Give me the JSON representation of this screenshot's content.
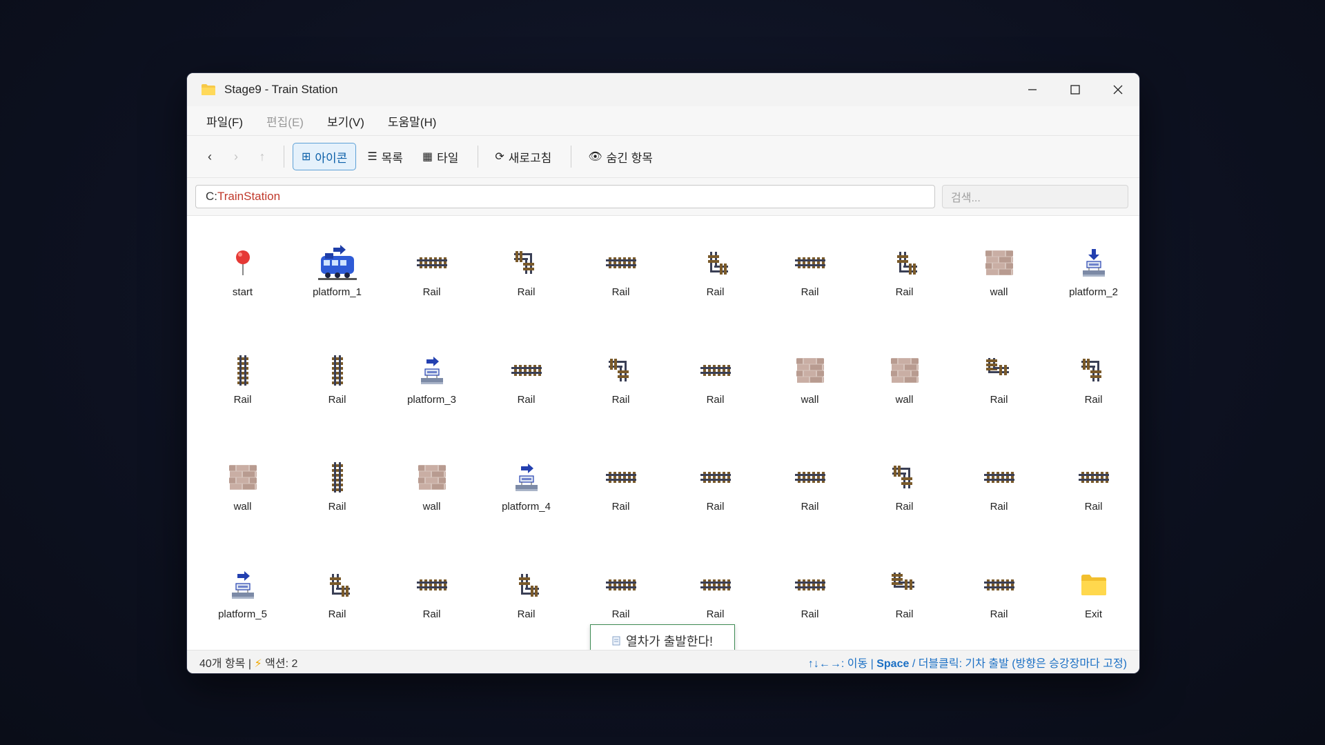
{
  "window": {
    "title": "Stage9 - Train Station",
    "controls": {
      "minimize": "—",
      "maximize": "☐",
      "close": "✕"
    }
  },
  "menu": [
    {
      "label": "파일(F)",
      "disabled": false
    },
    {
      "label": "편집(E)",
      "disabled": true
    },
    {
      "label": "보기(V)",
      "disabled": false
    },
    {
      "label": "도움말(H)",
      "disabled": false
    }
  ],
  "toolbar": {
    "back": "‹",
    "forward": "›",
    "up": "↑",
    "view_icon": "아이콘",
    "view_list": "목록",
    "view_tile": "타일",
    "refresh": "새로고침",
    "hidden_items": "숨긴 항목"
  },
  "address": {
    "drive": "C:",
    "path": "TrainStation"
  },
  "search": {
    "placeholder": "검색..."
  },
  "items": [
    {
      "label": "start",
      "icon": "pin-icon"
    },
    {
      "label": "platform_1",
      "icon": "train-icon"
    },
    {
      "label": "Rail",
      "icon": "rail-horizontal-icon"
    },
    {
      "label": "Rail",
      "icon": "rail-corner-down-icon"
    },
    {
      "label": "Rail",
      "icon": "rail-horizontal-icon"
    },
    {
      "label": "Rail",
      "icon": "rail-corner-up-icon"
    },
    {
      "label": "Rail",
      "icon": "rail-horizontal-icon"
    },
    {
      "label": "Rail",
      "icon": "rail-corner-up-icon"
    },
    {
      "label": "wall",
      "icon": "brick-wall-icon"
    },
    {
      "label": "platform_2",
      "icon": "platform-down-icon"
    },
    {
      "label": "Rail",
      "icon": "rail-vertical-icon"
    },
    {
      "label": "Rail",
      "icon": "rail-vertical-icon"
    },
    {
      "label": "platform_3",
      "icon": "platform-right-icon"
    },
    {
      "label": "Rail",
      "icon": "rail-horizontal-icon"
    },
    {
      "label": "Rail",
      "icon": "rail-corner-down-icon"
    },
    {
      "label": "Rail",
      "icon": "rail-horizontal-icon"
    },
    {
      "label": "wall",
      "icon": "brick-wall-icon"
    },
    {
      "label": "wall",
      "icon": "brick-wall-icon"
    },
    {
      "label": "Rail",
      "icon": "rail-corner-right-icon"
    },
    {
      "label": "Rail",
      "icon": "rail-corner-down-icon"
    },
    {
      "label": "wall",
      "icon": "brick-wall-icon"
    },
    {
      "label": "Rail",
      "icon": "rail-vertical-icon"
    },
    {
      "label": "wall",
      "icon": "brick-wall-icon"
    },
    {
      "label": "platform_4",
      "icon": "platform-right-icon"
    },
    {
      "label": "Rail",
      "icon": "rail-horizontal-icon"
    },
    {
      "label": "Rail",
      "icon": "rail-horizontal-icon"
    },
    {
      "label": "Rail",
      "icon": "rail-horizontal-icon"
    },
    {
      "label": "Rail",
      "icon": "rail-corner-down-icon"
    },
    {
      "label": "Rail",
      "icon": "rail-horizontal-icon"
    },
    {
      "label": "Rail",
      "icon": "rail-horizontal-icon"
    },
    {
      "label": "platform_5",
      "icon": "platform-right-icon"
    },
    {
      "label": "Rail",
      "icon": "rail-corner-up-icon"
    },
    {
      "label": "Rail",
      "icon": "rail-horizontal-icon"
    },
    {
      "label": "Rail",
      "icon": "rail-corner-up-icon"
    },
    {
      "label": "Rail",
      "icon": "rail-horizontal-icon"
    },
    {
      "label": "Rail",
      "icon": "rail-horizontal-icon"
    },
    {
      "label": "Rail",
      "icon": "rail-horizontal-icon"
    },
    {
      "label": "Rail",
      "icon": "rail-corner-right-icon"
    },
    {
      "label": "Rail",
      "icon": "rail-horizontal-icon"
    },
    {
      "label": "Exit",
      "icon": "folder-icon"
    }
  ],
  "toast": {
    "text": "열차가 출발한다!"
  },
  "status": {
    "count": "40개 항목 |",
    "action": "액션: 2",
    "hint_keys": "↑↓←→: 이동 |",
    "hint_space": "Space",
    "hint_rest": "/ 더블클릭: 기차 출발 (방향은 승강장마다 고정)"
  },
  "colors": {
    "accent": "#0b5fa8",
    "address_path": "#c0392b",
    "toast_border": "#3c8a52",
    "status_hint": "#1a6fc4"
  }
}
